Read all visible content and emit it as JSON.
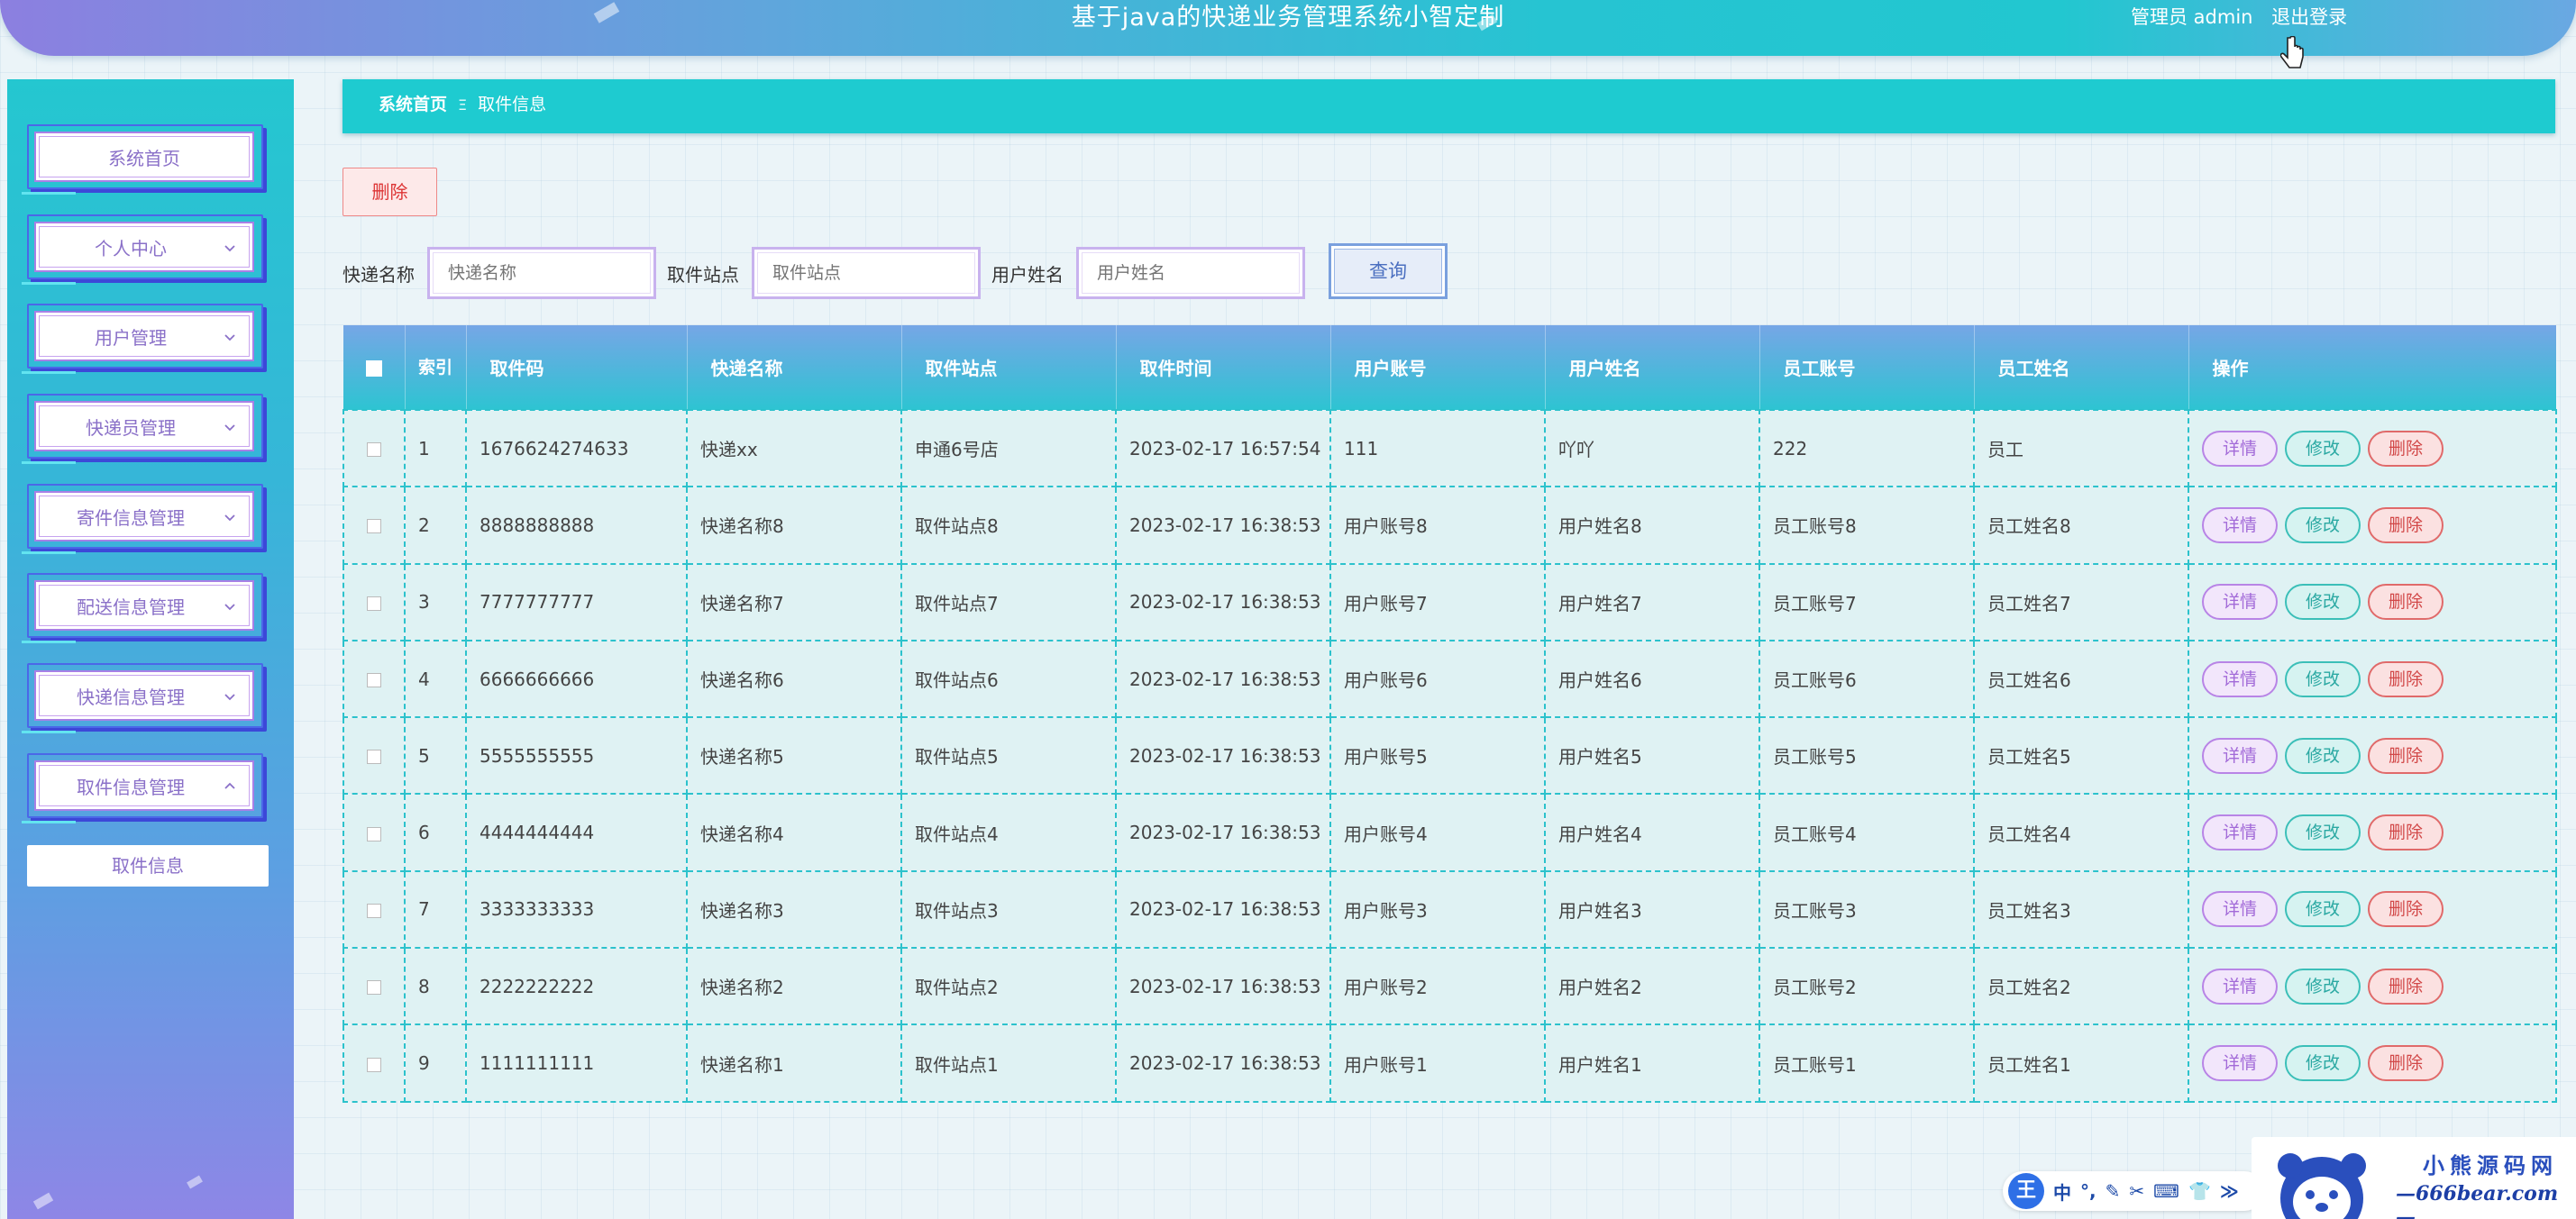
{
  "header": {
    "title": "基于java的快递业务管理系统小智定制",
    "user_label": "管理员 admin",
    "logout_label": "退出登录"
  },
  "sidebar": {
    "items": [
      {
        "label": "系统首页",
        "has_chevron": false
      },
      {
        "label": "个人中心",
        "has_chevron": true
      },
      {
        "label": "用户管理",
        "has_chevron": true
      },
      {
        "label": "快递员管理",
        "has_chevron": true
      },
      {
        "label": "寄件信息管理",
        "has_chevron": true
      },
      {
        "label": "配送信息管理",
        "has_chevron": true
      },
      {
        "label": "快递信息管理",
        "has_chevron": true
      },
      {
        "label": "取件信息管理",
        "has_chevron": true,
        "expanded": true
      }
    ],
    "sub_item": "取件信息"
  },
  "breadcrumb": {
    "home": "系统首页",
    "separator": "Ξ",
    "current": "取件信息"
  },
  "toolbar": {
    "delete_label": "删除"
  },
  "search": {
    "fields": [
      {
        "label": "快递名称",
        "placeholder": "快递名称"
      },
      {
        "label": "取件站点",
        "placeholder": "取件站点"
      },
      {
        "label": "用户姓名",
        "placeholder": "用户姓名"
      }
    ],
    "query_label": "查询"
  },
  "table": {
    "index_header": "索引",
    "headers": [
      "取件码",
      "快递名称",
      "取件站点",
      "取件时间",
      "用户账号",
      "用户姓名",
      "员工账号",
      "员工姓名",
      "操作"
    ],
    "action_labels": {
      "detail": "详情",
      "edit": "修改",
      "delete": "删除"
    },
    "rows": [
      [
        "1",
        "1676624274633",
        "快递xx",
        "申通6号店",
        "2023-02-17 16:57:54",
        "111",
        "吖吖",
        "222",
        "员工"
      ],
      [
        "2",
        "8888888888",
        "快递名称8",
        "取件站点8",
        "2023-02-17 16:38:53",
        "用户账号8",
        "用户姓名8",
        "员工账号8",
        "员工姓名8"
      ],
      [
        "3",
        "7777777777",
        "快递名称7",
        "取件站点7",
        "2023-02-17 16:38:53",
        "用户账号7",
        "用户姓名7",
        "员工账号7",
        "员工姓名7"
      ],
      [
        "4",
        "6666666666",
        "快递名称6",
        "取件站点6",
        "2023-02-17 16:38:53",
        "用户账号6",
        "用户姓名6",
        "员工账号6",
        "员工姓名6"
      ],
      [
        "5",
        "5555555555",
        "快递名称5",
        "取件站点5",
        "2023-02-17 16:38:53",
        "用户账号5",
        "用户姓名5",
        "员工账号5",
        "员工姓名5"
      ],
      [
        "6",
        "4444444444",
        "快递名称4",
        "取件站点4",
        "2023-02-17 16:38:53",
        "用户账号4",
        "用户姓名4",
        "员工账号4",
        "员工姓名4"
      ],
      [
        "7",
        "3333333333",
        "快递名称3",
        "取件站点3",
        "2023-02-17 16:38:53",
        "用户账号3",
        "用户姓名3",
        "员工账号3",
        "员工姓名3"
      ],
      [
        "8",
        "2222222222",
        "快递名称2",
        "取件站点2",
        "2023-02-17 16:38:53",
        "用户账号2",
        "用户姓名2",
        "员工账号2",
        "员工姓名2"
      ],
      [
        "9",
        "1111111111",
        "快递名称1",
        "取件站点1",
        "2023-02-17 16:38:53",
        "用户账号1",
        "用户姓名1",
        "员工账号1",
        "员工姓名1"
      ]
    ]
  },
  "ime_toolbar": {
    "logo": "王",
    "items": [
      "中",
      "°,",
      "✎",
      "✂",
      "⌨",
      "👕",
      "≫"
    ]
  },
  "watermark": {
    "line1": "小熊源码网",
    "line2": "—666bear.com—"
  },
  "colors": {
    "accent": "#1ecbd0",
    "menu_text": "#8a70c8",
    "danger": "#d24848",
    "edit": "#2aa8a2",
    "detail": "#a26ad8"
  }
}
